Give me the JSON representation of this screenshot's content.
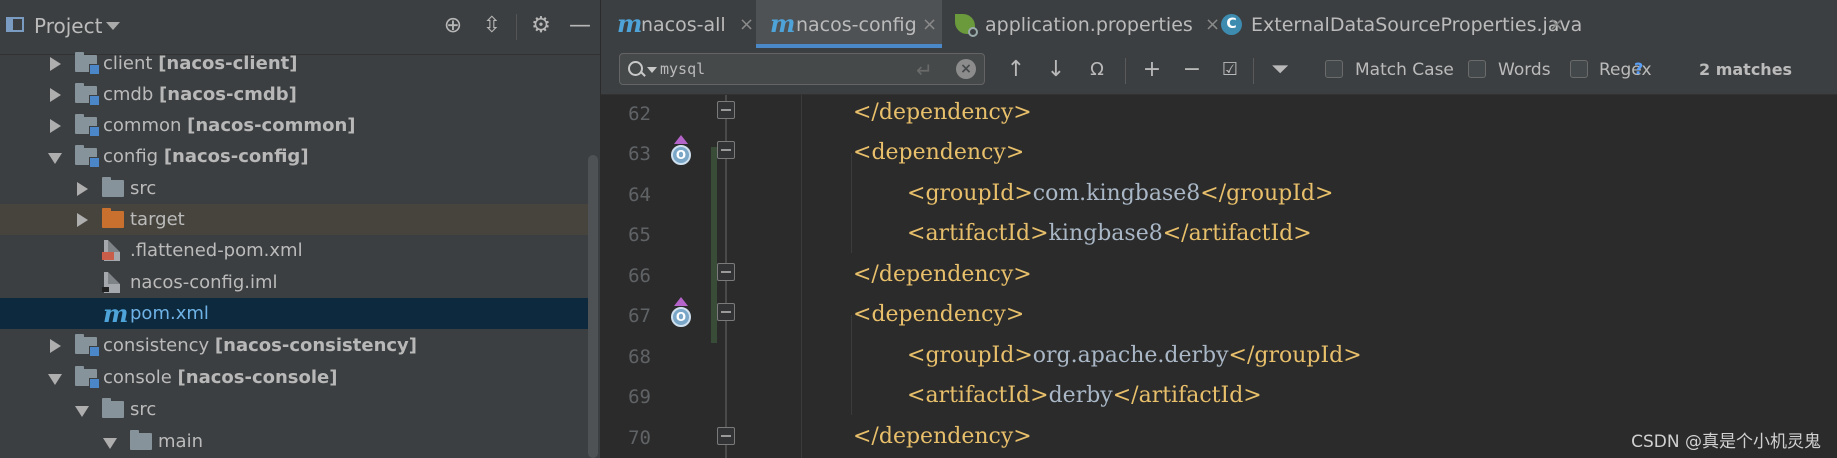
{
  "project_panel": {
    "title": "Project",
    "tree": [
      {
        "name": "client",
        "module": "[nacos-client]"
      },
      {
        "name": "cmdb",
        "module": "[nacos-cmdb]"
      },
      {
        "name": "common",
        "module": "[nacos-common]"
      },
      {
        "name": "config",
        "module": "[nacos-config]"
      },
      {
        "name": "src"
      },
      {
        "name": "target"
      },
      {
        "name": ".flattened-pom.xml"
      },
      {
        "name": "nacos-config.iml"
      },
      {
        "name": "pom.xml"
      },
      {
        "name": "consistency",
        "module": "[nacos-consistency]"
      },
      {
        "name": "console",
        "module": "[nacos-console]"
      },
      {
        "name": "src"
      },
      {
        "name": "main"
      }
    ]
  },
  "tabs": [
    {
      "label": "nacos-all",
      "close": "×"
    },
    {
      "label": "nacos-config",
      "close": "×"
    },
    {
      "label": "application.properties",
      "close": "×"
    },
    {
      "label": "ExternalDataSourceProperties.java",
      "close": "×"
    }
  ],
  "find": {
    "query": "mysql",
    "match_case": "Match Case",
    "words": "Words",
    "regex": "Regex",
    "help": "?",
    "matches": "2 matches"
  },
  "code": {
    "line_numbers": [
      "62",
      "63",
      "64",
      "65",
      "66",
      "67",
      "68",
      "69",
      "70"
    ],
    "lines": [
      {
        "open": "</",
        "tag": "dependency",
        "close": ">",
        "text": "",
        "end": ""
      },
      {
        "open": "<",
        "tag": "dependency",
        "close": ">",
        "text": "",
        "end": ""
      },
      {
        "open": "<",
        "tag": "groupId",
        "close": ">",
        "text": "com.kingbase8",
        "end": "</groupId>"
      },
      {
        "open": "<",
        "tag": "artifactId",
        "close": ">",
        "text": "kingbase8",
        "end": "</artifactId>"
      },
      {
        "open": "</",
        "tag": "dependency",
        "close": ">",
        "text": "",
        "end": ""
      },
      {
        "open": "<",
        "tag": "dependency",
        "close": ">",
        "text": "",
        "end": ""
      },
      {
        "open": "<",
        "tag": "groupId",
        "close": ">",
        "text": "org.apache.derby",
        "end": "</groupId>"
      },
      {
        "open": "<",
        "tag": "artifactId",
        "close": ">",
        "text": "derby",
        "end": "</artifactId>"
      },
      {
        "open": "</",
        "tag": "dependency",
        "close": ">",
        "text": "",
        "end": ""
      }
    ]
  },
  "impl_badge": "O",
  "watermark": "CSDN @真是个小机灵鬼"
}
